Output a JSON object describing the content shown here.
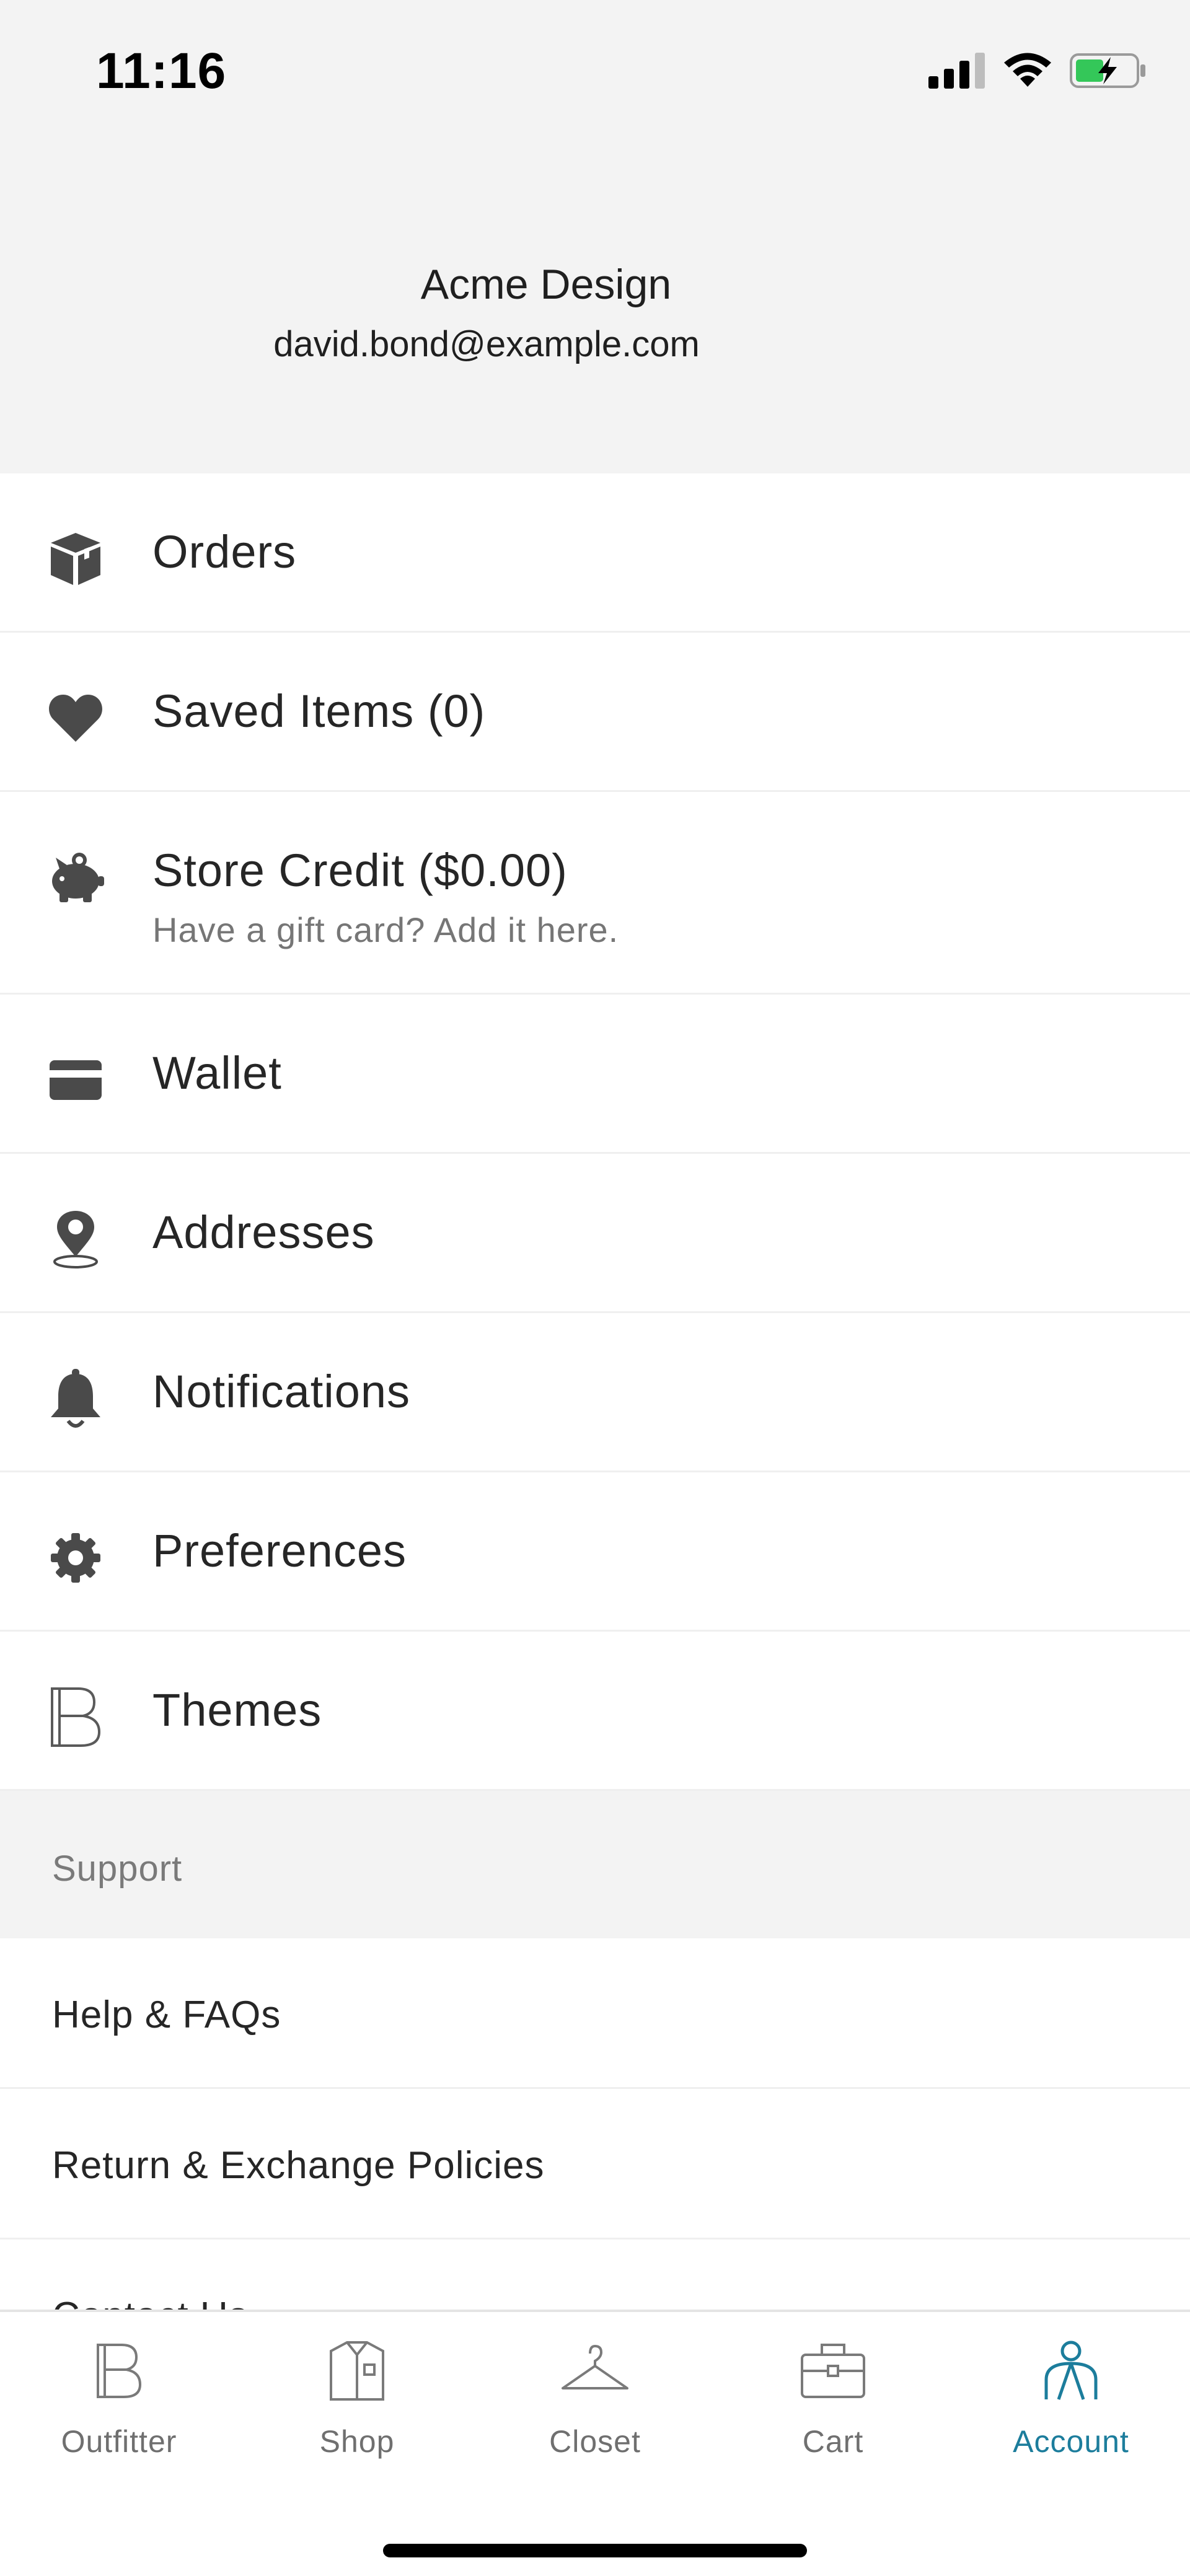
{
  "status_bar": {
    "time": "11:16"
  },
  "profile": {
    "name": "Acme Design",
    "email": "david.bond@example.com"
  },
  "menu": [
    {
      "label": "Orders",
      "icon": "box-icon"
    },
    {
      "label": "Saved Items (0)",
      "icon": "heart-icon"
    },
    {
      "label": "Store Credit ($0.00)",
      "sublabel": "Have a gift card? Add it here.",
      "icon": "piggy-bank-icon"
    },
    {
      "label": "Wallet",
      "icon": "credit-card-icon"
    },
    {
      "label": "Addresses",
      "icon": "location-pin-icon"
    },
    {
      "label": "Notifications",
      "icon": "bell-icon"
    },
    {
      "label": "Preferences",
      "icon": "gear-icon"
    },
    {
      "label": "Themes",
      "icon": "brand-b-icon"
    }
  ],
  "support": {
    "title": "Support",
    "items": [
      "Help & FAQs",
      "Return & Exchange Policies",
      "Contact Us"
    ]
  },
  "tabbar": {
    "active": "Account",
    "active_color": "#1c7d9c",
    "tabs": [
      {
        "label": "Outfitter",
        "icon": "brand-b-icon"
      },
      {
        "label": "Shop",
        "icon": "shirt-icon"
      },
      {
        "label": "Closet",
        "icon": "hanger-icon"
      },
      {
        "label": "Cart",
        "icon": "briefcase-icon"
      },
      {
        "label": "Account",
        "icon": "person-icon"
      }
    ]
  }
}
